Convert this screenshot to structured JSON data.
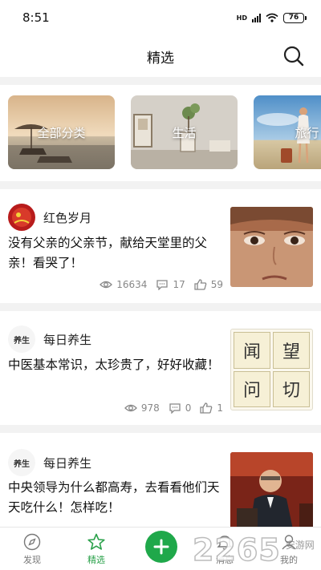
{
  "status_bar": {
    "time": "8:51",
    "network_label": "HD",
    "battery_level": "76"
  },
  "header": {
    "title": "精选",
    "search_icon": "search-icon"
  },
  "categories": [
    {
      "label": "全部分类"
    },
    {
      "label": "生活"
    },
    {
      "label": "旅行"
    }
  ],
  "articles": [
    {
      "author": "红色岁月",
      "avatar_text": "红色岁月",
      "title": "没有父亲的父亲节，献给天堂里的父亲！看哭了！",
      "views": "16634",
      "comments": "17",
      "likes": "59"
    },
    {
      "author": "每日养生",
      "avatar_text": "养生",
      "title": "中医基本常识，太珍贵了，好好收藏！",
      "views": "978",
      "comments": "0",
      "likes": "1",
      "thumb_chars": [
        "闻",
        "望",
        "问",
        "切"
      ]
    },
    {
      "author": "每日养生",
      "avatar_text": "养生",
      "title": "中央领导为什么都高寿，去看看他们天天吃什么！怎样吃！"
    }
  ],
  "tab_bar": {
    "tabs": [
      {
        "label": "发现",
        "icon": "compass-icon"
      },
      {
        "label": "精选",
        "icon": "star-icon"
      },
      {
        "label": "消息",
        "icon": "bell-icon"
      },
      {
        "label": "我的",
        "icon": "user-icon"
      }
    ],
    "add_icon": "plus-icon"
  },
  "watermark": {
    "digits": "2265",
    "site": "安游网"
  },
  "colors": {
    "accent": "#2aa14a",
    "divider": "#f2f2f2",
    "meta_text": "#888888"
  }
}
